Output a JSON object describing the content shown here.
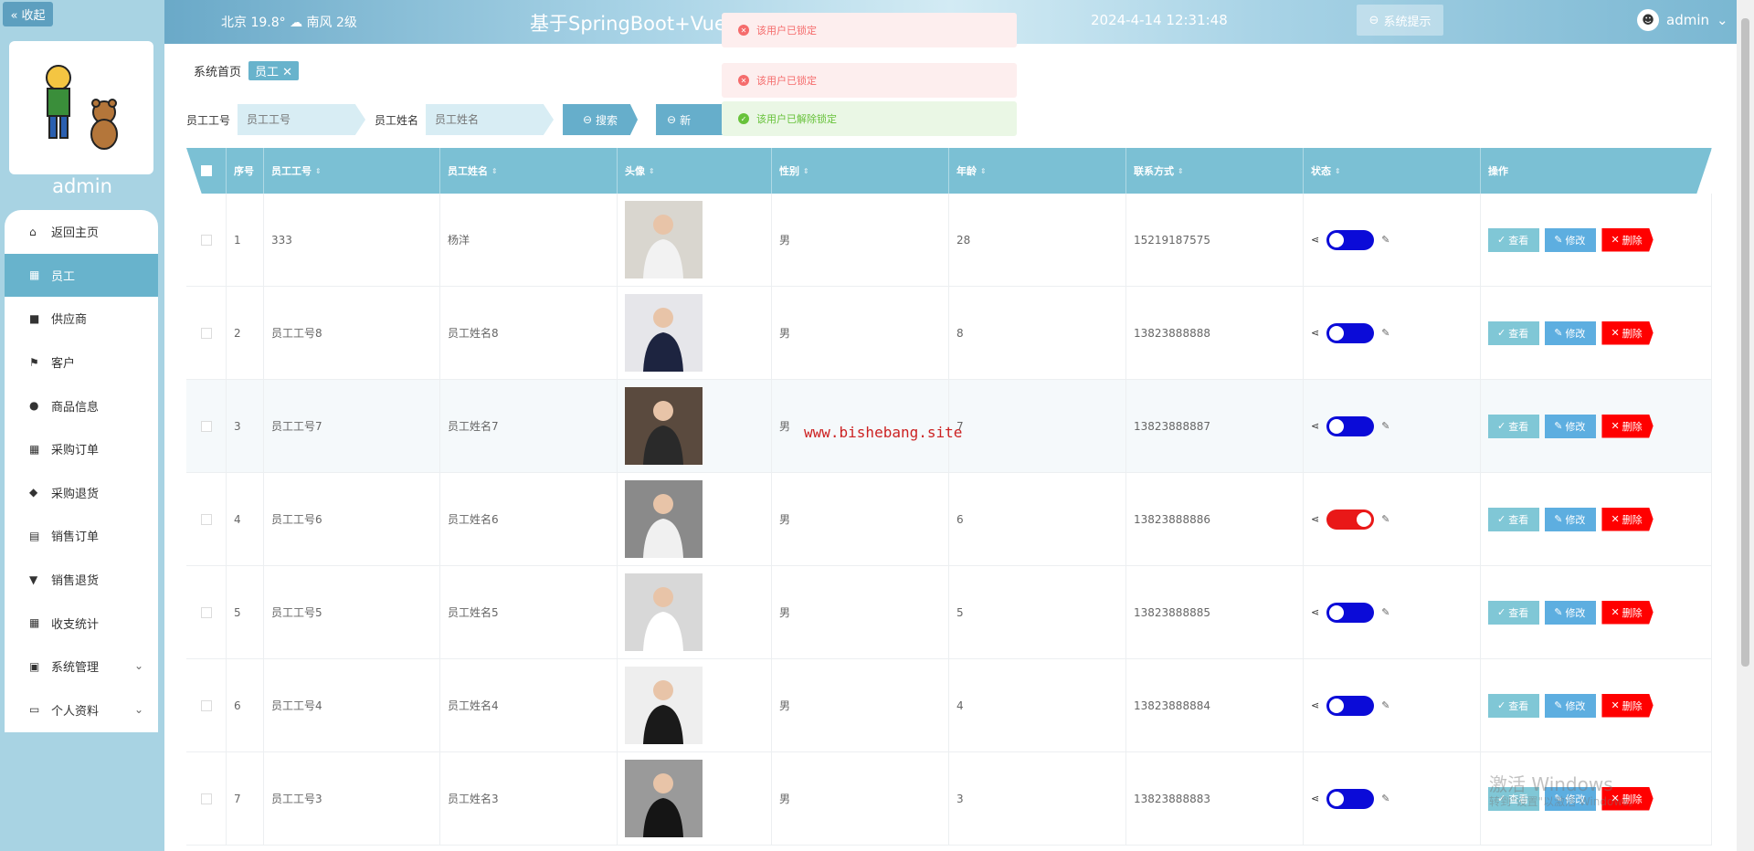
{
  "sidebar": {
    "collapse_label": "« 收起",
    "admin_name": "admin",
    "items": [
      {
        "label": "返回主页",
        "icon": "home-icon",
        "glyph": "⌂"
      },
      {
        "label": "员工",
        "icon": "grid-icon",
        "glyph": "▦"
      },
      {
        "label": "供应商",
        "icon": "box-icon",
        "glyph": "■"
      },
      {
        "label": "客户",
        "icon": "flag-icon",
        "glyph": "⚑"
      },
      {
        "label": "商品信息",
        "icon": "user-icon",
        "glyph": "●"
      },
      {
        "label": "采购订单",
        "icon": "grid-icon",
        "glyph": "▦"
      },
      {
        "label": "采购退货",
        "icon": "pin-icon",
        "glyph": "◆"
      },
      {
        "label": "销售订单",
        "icon": "bag-icon",
        "glyph": "▤"
      },
      {
        "label": "销售退货",
        "icon": "cup-icon",
        "glyph": "▼"
      },
      {
        "label": "收支统计",
        "icon": "grid-icon",
        "glyph": "▦"
      },
      {
        "label": "系统管理",
        "icon": "chart-icon",
        "glyph": "▣"
      },
      {
        "label": "个人资料",
        "icon": "card-icon",
        "glyph": "▭"
      }
    ]
  },
  "header": {
    "weather": "北京  19.8°  ☁  南风  2级",
    "title": "基于SpringBoot+Vue的",
    "datetime": "2024-4-14 12:31:48",
    "sys_button": "系统提示",
    "user": "admin"
  },
  "breadcrumb": {
    "home": "系统首页",
    "tag": "员工"
  },
  "search": {
    "id_label": "员工工号",
    "id_placeholder": "员工工号",
    "name_label": "员工姓名",
    "name_placeholder": "员工姓名",
    "search_button": "搜索",
    "add_button": "新"
  },
  "table": {
    "headers": [
      "序号",
      "员工工号",
      "员工姓名",
      "头像",
      "性别",
      "年龄",
      "联系方式",
      "状态",
      "操作"
    ],
    "ops": {
      "view": "查看",
      "edit": "修改",
      "delete": "删除"
    },
    "rows": [
      {
        "no": "1",
        "id": "333",
        "name": "杨洋",
        "sex": "男",
        "age": "28",
        "phone": "15219187575",
        "locked": false
      },
      {
        "no": "2",
        "id": "员工工号8",
        "name": "员工姓名8",
        "sex": "男",
        "age": "8",
        "phone": "13823888888",
        "locked": false
      },
      {
        "no": "3",
        "id": "员工工号7",
        "name": "员工姓名7",
        "sex": "男",
        "age": "7",
        "phone": "13823888887",
        "locked": false
      },
      {
        "no": "4",
        "id": "员工工号6",
        "name": "员工姓名6",
        "sex": "男",
        "age": "6",
        "phone": "13823888886",
        "locked": true
      },
      {
        "no": "5",
        "id": "员工工号5",
        "name": "员工姓名5",
        "sex": "男",
        "age": "5",
        "phone": "13823888885",
        "locked": false
      },
      {
        "no": "6",
        "id": "员工工号4",
        "name": "员工姓名4",
        "sex": "男",
        "age": "4",
        "phone": "13823888884",
        "locked": false
      },
      {
        "no": "7",
        "id": "员工工号3",
        "name": "员工姓名3",
        "sex": "男",
        "age": "3",
        "phone": "13823888883",
        "locked": false
      }
    ]
  },
  "notifications": [
    {
      "type": "error",
      "text": "该用户已锁定"
    },
    {
      "type": "error",
      "text": "该用户已锁定"
    },
    {
      "type": "success",
      "text": "该用户已解除锁定"
    }
  ],
  "watermark": "www.bishebang.site",
  "windows_activation": {
    "line1": "激活 Windows",
    "line2": "转到\"设置\"以激活 Windows。"
  },
  "colors": {
    "accent": "#68b3cc",
    "header": "#a8d3e6",
    "danger": "#ff0000",
    "toggle_off": "#0b0bd8",
    "toggle_on": "#e91818"
  }
}
